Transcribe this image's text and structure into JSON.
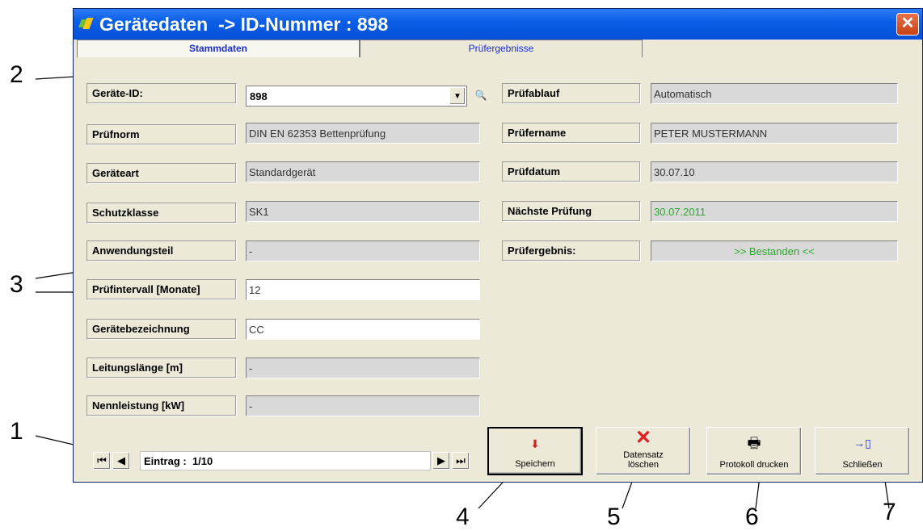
{
  "window": {
    "title": "Gerätedaten  -> ID-Nummer : 898",
    "close_glyph": "✕"
  },
  "tabs": [
    {
      "label": "Stammdaten",
      "active": true
    },
    {
      "label": "Prüfergebnisse",
      "active": false
    }
  ],
  "left_fields": [
    {
      "label": "Geräte-ID:",
      "value": "898"
    },
    {
      "label": "Prüfnorm",
      "value": "DIN EN 62353 Bettenprüfung"
    },
    {
      "label": "Geräteart",
      "value": "Standardgerät"
    },
    {
      "label": "Schutzklasse",
      "value": "SK1"
    },
    {
      "label": "Anwendungsteil",
      "value": "-"
    },
    {
      "label": "Prüfintervall [Monate]",
      "value": "12"
    },
    {
      "label": "Gerätebezeichnung",
      "value": "CC"
    },
    {
      "label": "Leitungslänge [m]",
      "value": "-"
    },
    {
      "label": "Nennleistung [kW]",
      "value": "-"
    }
  ],
  "right_fields": [
    {
      "label": "Prüfablauf",
      "value": "Automatisch"
    },
    {
      "label": "Prüfername",
      "value": "PETER MUSTERMANN"
    },
    {
      "label": "Prüfdatum",
      "value": "30.07.10"
    },
    {
      "label": "Nächste Prüfung",
      "value": "30.07.2011"
    },
    {
      "label": "Prüfergebnis:",
      "value": ">> Bestanden <<"
    }
  ],
  "navigation": {
    "entry_text": "Eintrag :  1/10"
  },
  "buttons": {
    "save": "Speichern",
    "delete_line1": "Datensatz",
    "delete_line2": "löschen",
    "print": "Protokoll drucken",
    "close": "Schließen"
  },
  "annotations": [
    "1",
    "2",
    "3",
    "4",
    "5",
    "6",
    "7"
  ],
  "colors": {
    "titlebar": "#0550d8",
    "tab_text": "#1a2ed0",
    "next_test_date": "#2aa82a",
    "delete_icon": "#e02020"
  }
}
